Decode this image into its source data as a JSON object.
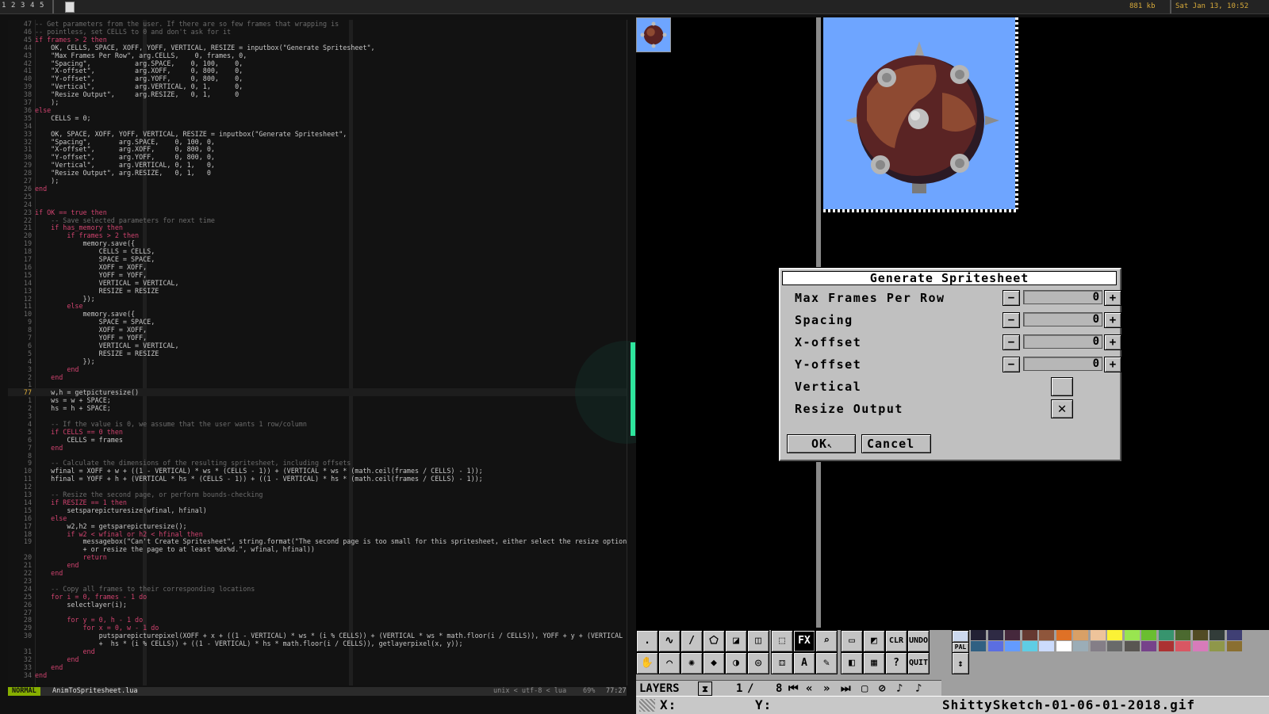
{
  "topbar": {
    "workspaces": [
      "1",
      "2",
      "3",
      "4",
      "5"
    ],
    "memory": "881 kb",
    "datetime": "Sat Jan 13, 10:52"
  },
  "editor": {
    "lines": [
      {
        "n": "47",
        "t": "-- Get parameters from the user. If there are so few frames that wrapping is"
      },
      {
        "n": "46",
        "t": "-- pointless, set CELLS to 0 and don't ask for it"
      },
      {
        "n": "45",
        "t": "if frames > 2 then"
      },
      {
        "n": "44",
        "t": "    OK, CELLS, SPACE, XOFF, YOFF, VERTICAL, RESIZE = inputbox(\"Generate Spritesheet\","
      },
      {
        "n": "43",
        "t": "    \"Max Frames Per Row\", arg.CELLS,    0, frames, 0,"
      },
      {
        "n": "42",
        "t": "    \"Spacing\",           arg.SPACE,    0, 100,    0,"
      },
      {
        "n": "41",
        "t": "    \"X-offset\",          arg.XOFF,     0, 800,    0,"
      },
      {
        "n": "40",
        "t": "    \"Y-offset\",          arg.YOFF,     0, 800,    0,"
      },
      {
        "n": "39",
        "t": "    \"Vertical\",          arg.VERTICAL, 0, 1,      0,"
      },
      {
        "n": "38",
        "t": "    \"Resize Output\",     arg.RESIZE,   0, 1,      0"
      },
      {
        "n": "37",
        "t": "    );"
      },
      {
        "n": "36",
        "t": "else"
      },
      {
        "n": "35",
        "t": "    CELLS = 0;"
      },
      {
        "n": "34",
        "t": ""
      },
      {
        "n": "33",
        "t": "    OK, SPACE, XOFF, YOFF, VERTICAL, RESIZE = inputbox(\"Generate Spritesheet\","
      },
      {
        "n": "32",
        "t": "    \"Spacing\",       arg.SPACE,    0, 100, 0,"
      },
      {
        "n": "31",
        "t": "    \"X-offset\",      arg.XOFF,     0, 800, 0,"
      },
      {
        "n": "30",
        "t": "    \"Y-offset\",      arg.YOFF,     0, 800, 0,"
      },
      {
        "n": "29",
        "t": "    \"Vertical\",      arg.VERTICAL, 0, 1,   0,"
      },
      {
        "n": "28",
        "t": "    \"Resize Output\", arg.RESIZE,   0, 1,   0"
      },
      {
        "n": "27",
        "t": "    );"
      },
      {
        "n": "26",
        "t": "end"
      },
      {
        "n": "25",
        "t": ""
      },
      {
        "n": "24",
        "t": ""
      },
      {
        "n": "23",
        "t": "if OK == true then"
      },
      {
        "n": "22",
        "t": "    -- Save selected parameters for next time"
      },
      {
        "n": "21",
        "t": "    if has_memory then"
      },
      {
        "n": "20",
        "t": "        if frames > 2 then"
      },
      {
        "n": "19",
        "t": "            memory.save({"
      },
      {
        "n": "18",
        "t": "                CELLS = CELLS,"
      },
      {
        "n": "17",
        "t": "                SPACE = SPACE,"
      },
      {
        "n": "16",
        "t": "                XOFF = XOFF,"
      },
      {
        "n": "15",
        "t": "                YOFF = YOFF,"
      },
      {
        "n": "14",
        "t": "                VERTICAL = VERTICAL,"
      },
      {
        "n": "13",
        "t": "                RESIZE = RESIZE"
      },
      {
        "n": "12",
        "t": "            });"
      },
      {
        "n": "11",
        "t": "        else"
      },
      {
        "n": "10",
        "t": "            memory.save({"
      },
      {
        "n": "9",
        "t": "                SPACE = SPACE,"
      },
      {
        "n": "8",
        "t": "                XOFF = XOFF,"
      },
      {
        "n": "7",
        "t": "                YOFF = YOFF,"
      },
      {
        "n": "6",
        "t": "                VERTICAL = VERTICAL,"
      },
      {
        "n": "5",
        "t": "                RESIZE = RESIZE"
      },
      {
        "n": "4",
        "t": "            });"
      },
      {
        "n": "3",
        "t": "        end"
      },
      {
        "n": "2",
        "t": "    end"
      },
      {
        "n": "1",
        "t": ""
      },
      {
        "n": "77",
        "t": "    w,h = getpicturesize()",
        "cur": true
      },
      {
        "n": "1",
        "t": "    ws = w + SPACE;"
      },
      {
        "n": "2",
        "t": "    hs = h + SPACE;"
      },
      {
        "n": "3",
        "t": ""
      },
      {
        "n": "4",
        "t": "    -- If the value is 0, we assume that the user wants 1 row/column"
      },
      {
        "n": "5",
        "t": "    if CELLS == 0 then"
      },
      {
        "n": "6",
        "t": "        CELLS = frames"
      },
      {
        "n": "7",
        "t": "    end"
      },
      {
        "n": "8",
        "t": ""
      },
      {
        "n": "9",
        "t": "    -- Calculate the dimensions of the resulting spritesheet, including offsets"
      },
      {
        "n": "10",
        "t": "    wfinal = XOFF + w + ((1 - VERTICAL) * ws * (CELLS - 1)) + (VERTICAL * ws * (math.ceil(frames / CELLS) - 1));"
      },
      {
        "n": "11",
        "t": "    hfinal = YOFF + h + (VERTICAL * hs * (CELLS - 1)) + ((1 - VERTICAL) * hs * (math.ceil(frames / CELLS) - 1));"
      },
      {
        "n": "12",
        "t": ""
      },
      {
        "n": "13",
        "t": "    -- Resize the second page, or perform bounds-checking"
      },
      {
        "n": "14",
        "t": "    if RESIZE == 1 then"
      },
      {
        "n": "15",
        "t": "        setsparepicturesize(wfinal, hfinal)"
      },
      {
        "n": "16",
        "t": "    else"
      },
      {
        "n": "17",
        "t": "        w2,h2 = getsparepicturesize();"
      },
      {
        "n": "18",
        "t": "        if w2 < wfinal or h2 < hfinal then"
      },
      {
        "n": "19",
        "t": "            messagebox(\"Can't Create Spritesheet\", string.format(\"The second page is too small for this spritesheet, either select the resize option"
      },
      {
        "n": "",
        "t": "            + or resize the page to at least %dx%d.\", wfinal, hfinal))"
      },
      {
        "n": "20",
        "t": "            return"
      },
      {
        "n": "21",
        "t": "        end"
      },
      {
        "n": "22",
        "t": "    end"
      },
      {
        "n": "23",
        "t": ""
      },
      {
        "n": "24",
        "t": "    -- Copy all frames to their corresponding locations"
      },
      {
        "n": "25",
        "t": "    for i = 0, frames - 1 do"
      },
      {
        "n": "26",
        "t": "        selectlayer(i);"
      },
      {
        "n": "27",
        "t": ""
      },
      {
        "n": "28",
        "t": "        for y = 0, h - 1 do"
      },
      {
        "n": "29",
        "t": "            for x = 0, w - 1 do"
      },
      {
        "n": "30",
        "t": "                putsparepicturepixel(XOFF + x + ((1 - VERTICAL) * ws * (i % CELLS)) + (VERTICAL * ws * math.floor(i / CELLS)), YOFF + y + (VERTICAL *"
      },
      {
        "n": "",
        "t": "                +  hs * (i % CELLS)) + ((1 - VERTICAL) * hs * math.floor(i / CELLS)), getlayerpixel(x, y));"
      },
      {
        "n": "31",
        "t": "            end"
      },
      {
        "n": "32",
        "t": "        end"
      },
      {
        "n": "33",
        "t": "    end"
      },
      {
        "n": "34",
        "t": "end"
      }
    ]
  },
  "statusline": {
    "mode": "NORMAL",
    "file": "AnimToSpritesheet.lua",
    "encoding": "unix < utf-8 < lua",
    "percent": "69%",
    "position": "77:27"
  },
  "dialog": {
    "title": "Generate Spritesheet",
    "fields": [
      {
        "label": "Max Frames Per Row",
        "value": "0"
      },
      {
        "label": "Spacing",
        "value": "0"
      },
      {
        "label": "X-offset",
        "value": "0"
      },
      {
        "label": "Y-offset",
        "value": "0"
      }
    ],
    "minus": "−",
    "plus": "+",
    "checkboxes": [
      {
        "label": "Vertical",
        "mark": ""
      },
      {
        "label": "Resize Output",
        "mark": "✕"
      }
    ],
    "ok_label": "OK",
    "cancel_label": "Cancel"
  },
  "toolbar": {
    "row1": [
      ".",
      "∿",
      "/",
      "⬠",
      "◪",
      "◫",
      "⬚",
      "FX",
      "⌕",
      "▭",
      "◩",
      "CLR",
      "UNDO"
    ],
    "row2": [
      "✋",
      "⌒",
      "✺",
      "◆",
      "◑",
      "◎",
      "⚃",
      "A",
      "✎",
      "◧",
      "▦",
      "?",
      "QUIT"
    ],
    "pal_label": "PAL",
    "palette": [
      "#222034",
      "#2e2a44",
      "#45283c",
      "#663931",
      "#8f563b",
      "#df7126",
      "#d9a066",
      "#eec39a",
      "#fbf236",
      "#99e550",
      "#6abe30",
      "#37946e",
      "#4b692f",
      "#524b24",
      "#323c39",
      "#3f3f74",
      "#306082",
      "#5b6ee1",
      "#639bff",
      "#5fcde4",
      "#cbdbfc",
      "#ffffff",
      "#9badb7",
      "#847e87",
      "#696a6a",
      "#595652",
      "#76428a",
      "#ac3232",
      "#d95763",
      "#d77bba",
      "#8f974a",
      "#8a6f30"
    ]
  },
  "layers": {
    "label": "LAYERS",
    "current": "1",
    "total": "8"
  },
  "bottombar": {
    "x_label": "X:",
    "y_label": "Y:",
    "filename": "ShittySketch-01-06-01-2018.gif"
  },
  "colors": {
    "keyword": "#d0436f",
    "comment": "#6c6c6c",
    "string": "#87af5f",
    "number": "#a878d8",
    "func": "#e5a13a",
    "canvas_bg": "#6ea5ff",
    "sprite_body": "#6a2a2a",
    "sprite_light": "#8e4a32",
    "sprite_spike": "#a0a0a0"
  }
}
